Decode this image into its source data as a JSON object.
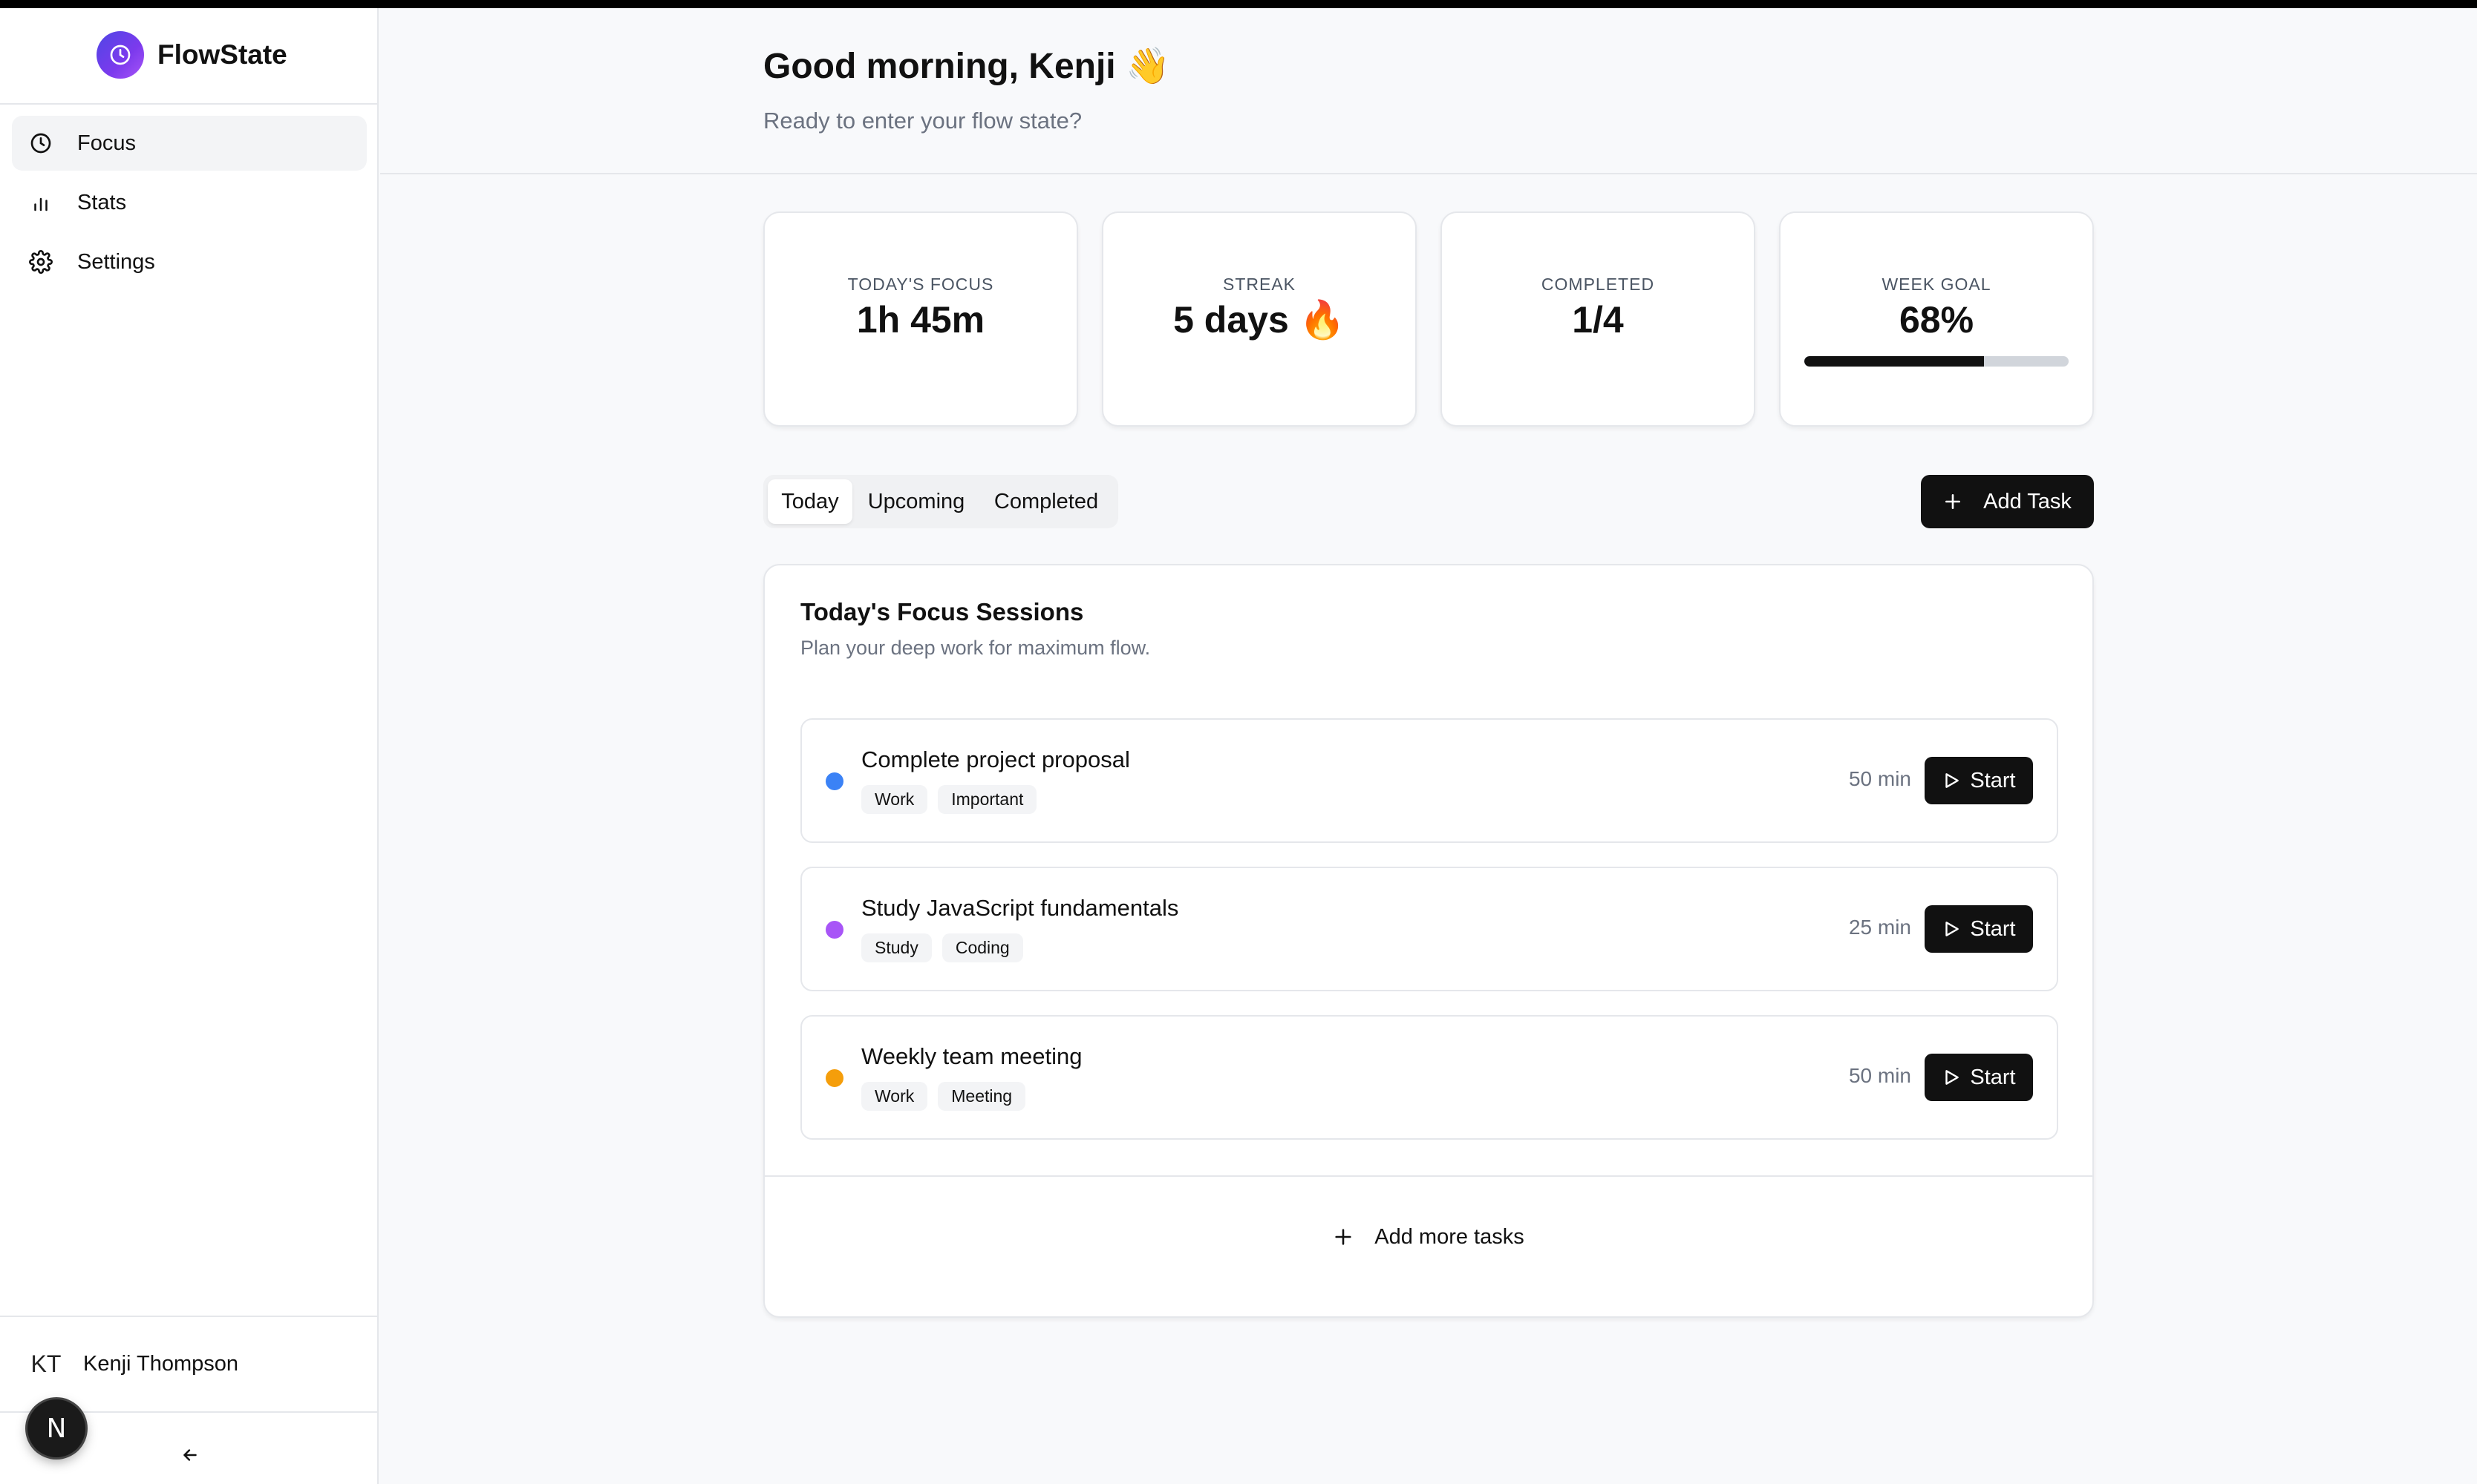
{
  "app": {
    "name": "FlowState"
  },
  "sidebar": {
    "items": [
      {
        "label": "Focus",
        "icon": "clock-icon",
        "active": true
      },
      {
        "label": "Stats",
        "icon": "bar-chart-icon",
        "active": false
      },
      {
        "label": "Settings",
        "icon": "gear-icon",
        "active": false
      }
    ],
    "user": {
      "initials": "KT",
      "name": "Kenji Thompson"
    },
    "badge": "N"
  },
  "header": {
    "greeting": "Good morning, Kenji 👋",
    "subtitle": "Ready to enter your flow state?"
  },
  "stats": [
    {
      "label": "TODAY'S FOCUS",
      "value": "1h 45m"
    },
    {
      "label": "STREAK",
      "value": "5 days 🔥"
    },
    {
      "label": "COMPLETED",
      "value": "1/4"
    },
    {
      "label": "WEEK GOAL",
      "value": "68%",
      "progress": 0.68
    }
  ],
  "tabs": [
    {
      "label": "Today",
      "active": true
    },
    {
      "label": "Upcoming",
      "active": false
    },
    {
      "label": "Completed",
      "active": false
    }
  ],
  "add_task_label": "Add Task",
  "sessions": {
    "title": "Today's Focus Sessions",
    "subtitle": "Plan your deep work for maximum flow.",
    "tasks": [
      {
        "name": "Complete project proposal",
        "tags": [
          "Work",
          "Important"
        ],
        "duration": "50 min",
        "color": "#3b82f6",
        "action": "Start"
      },
      {
        "name": "Study JavaScript fundamentals",
        "tags": [
          "Study",
          "Coding"
        ],
        "duration": "25 min",
        "color": "#a855f7",
        "action": "Start"
      },
      {
        "name": "Weekly team meeting",
        "tags": [
          "Work",
          "Meeting"
        ],
        "duration": "50 min",
        "color": "#f59e0b",
        "action": "Start"
      }
    ],
    "add_more_label": "Add more tasks"
  },
  "colors": {
    "accent": "#111111",
    "brand": "#6d4aff"
  }
}
